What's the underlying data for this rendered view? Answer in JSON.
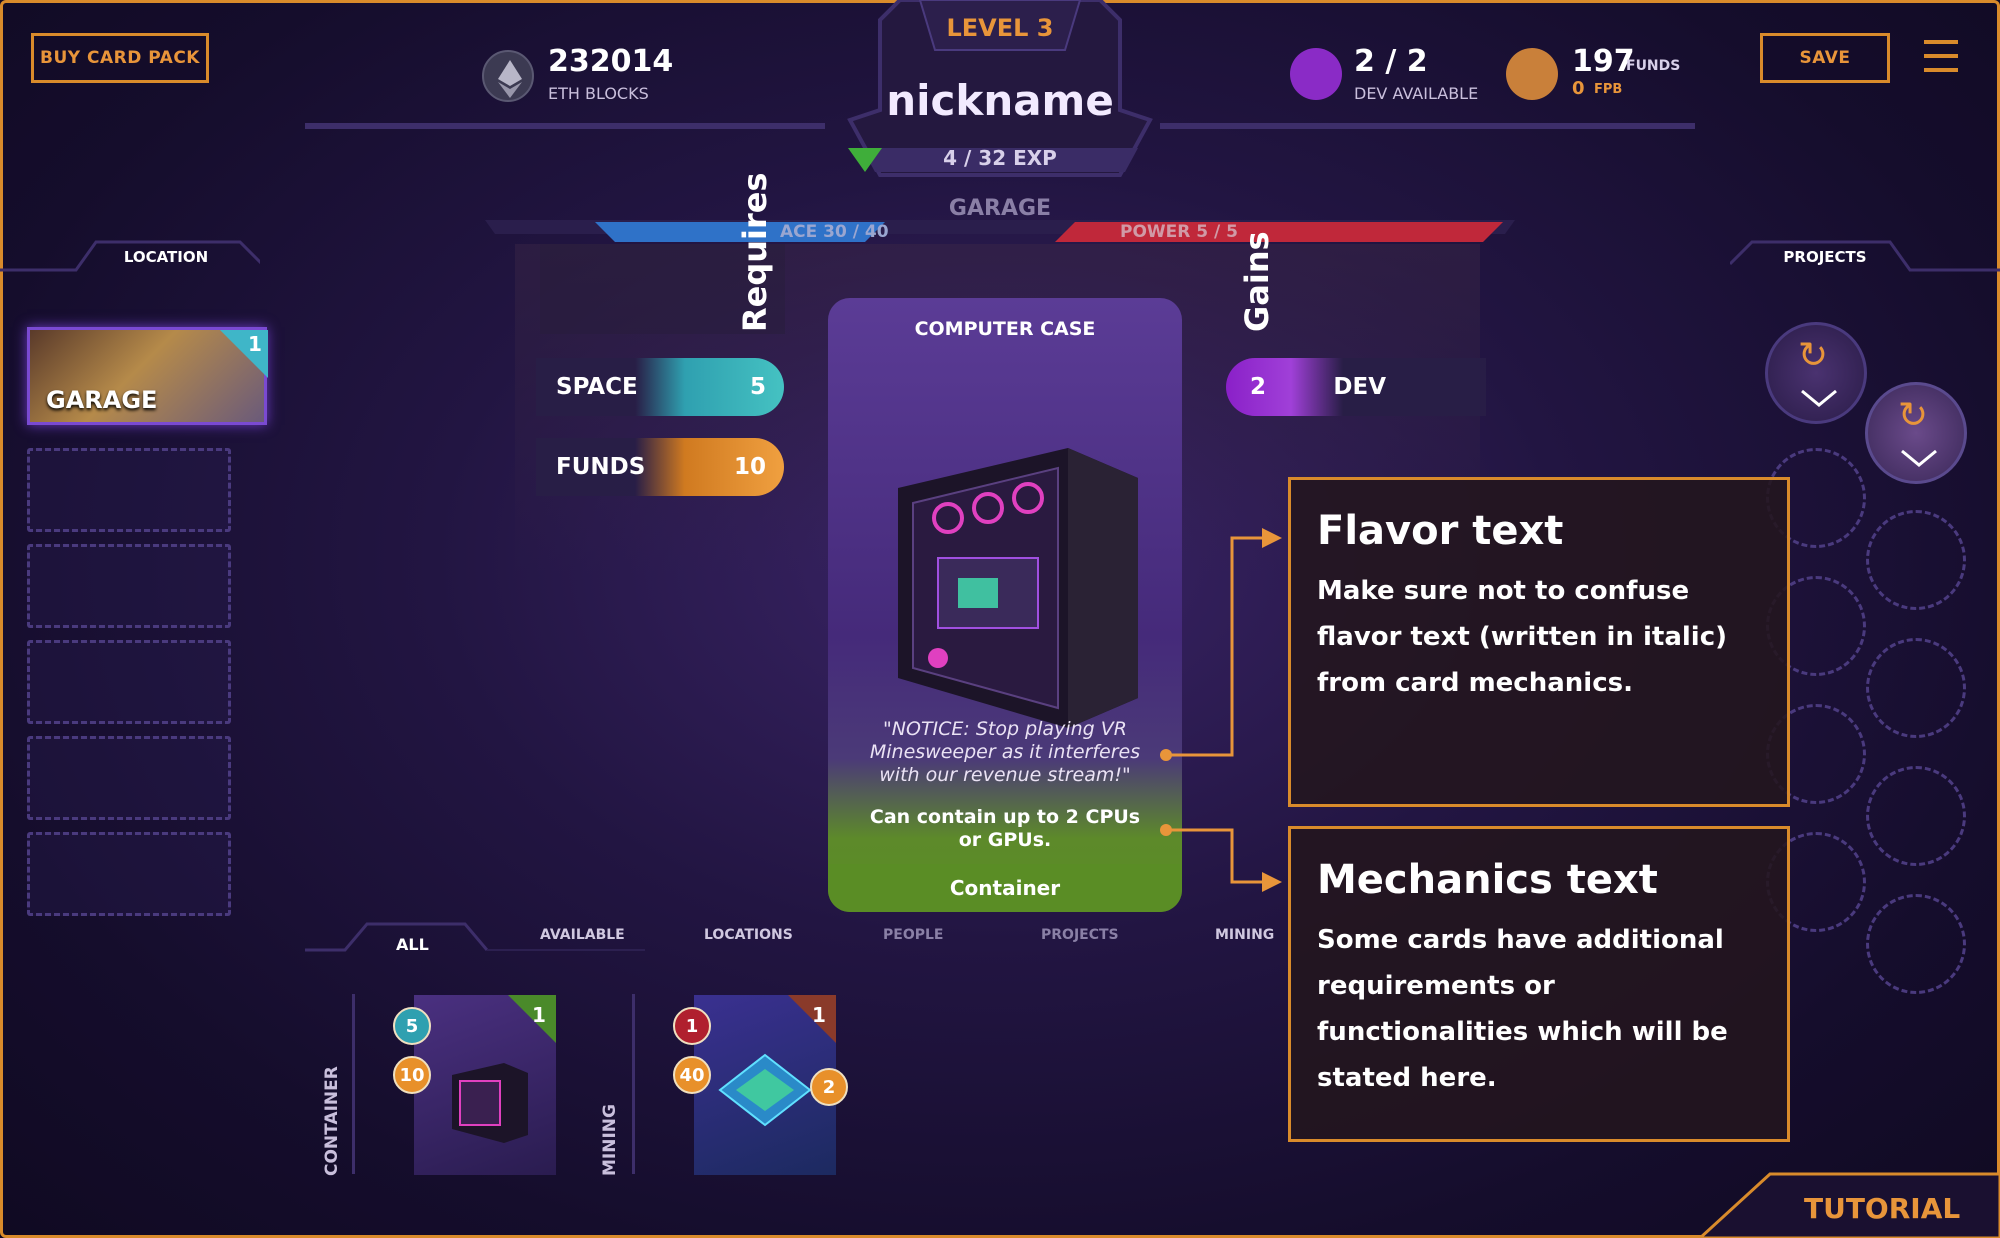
{
  "header": {
    "buy_card_pack": "BUY CARD PACK",
    "save": "SAVE",
    "level": "LEVEL 3",
    "nickname": "nickname",
    "exp": "4 / 32 EXP",
    "eth_value": "232014",
    "eth_label": "ETH BLOCKS",
    "dev_value": "2 / 2",
    "dev_label": "DEV AVAILABLE",
    "funds_value": "197",
    "funds_unit": "FUNDS",
    "fpb_value": "0",
    "fpb_unit": "FPB",
    "exp_progress": 0.125
  },
  "location_bar": {
    "title": "GARAGE",
    "space": "ACE  30 / 40",
    "power": "POWER  5 / 5"
  },
  "left_panel": {
    "title": "LOCATION",
    "garage_label": "GARAGE",
    "garage_count": "1"
  },
  "right_panel": {
    "title": "PROJECTS"
  },
  "requires": {
    "label": "Requires",
    "items": [
      {
        "name": "SPACE",
        "value": "5"
      },
      {
        "name": "FUNDS",
        "value": "10"
      }
    ]
  },
  "gains": {
    "label": "Gains",
    "items": [
      {
        "value": "2",
        "name": "DEV"
      }
    ]
  },
  "card": {
    "title": "COMPUTER CASE",
    "flavor": "\"NOTICE: Stop playing VR Minesweeper as it interferes with our revenue stream!\"",
    "mechanics": "Can contain up to 2 CPUs or GPUs.",
    "type": "Container"
  },
  "callouts": {
    "flavor_title": "Flavor text",
    "flavor_body": "Make sure not to confuse flavor text (written in italic) from card mechanics.",
    "mechanics_title": "Mechanics text",
    "mechanics_body": "Some cards have additional requirements or functionalities which will be stated here."
  },
  "tabs": [
    "ALL",
    "AVAILABLE",
    "LOCATIONS",
    "PEOPLE",
    "PROJECTS",
    "MINING"
  ],
  "hand": {
    "container_label": "CONTAINER",
    "mining_label": "MINING",
    "case_count": "1",
    "case_space": "5",
    "case_funds": "10",
    "chip_count": "1",
    "chip_a": "1",
    "chip_b": "40",
    "chip_c": "2"
  },
  "tutorial": "TUTORIAL",
  "colors": {
    "accent": "#d98b2b",
    "space": "#3fb6b8",
    "funds": "#e8902a",
    "dev": "#9a2fd1",
    "mechanics_green": "#5a8d25"
  }
}
